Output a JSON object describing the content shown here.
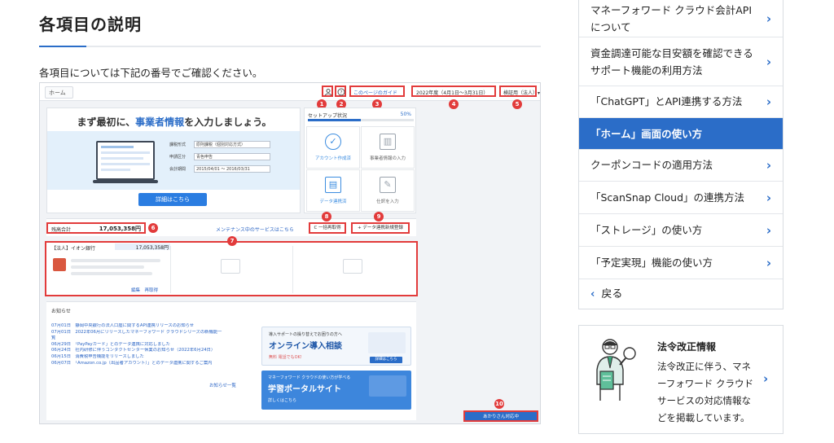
{
  "article": {
    "title": "各項目の説明",
    "lead": "各項目については下記の番号でご確認ください。"
  },
  "screenshot": {
    "breadcrumb": "ホーム",
    "header": {
      "guide_link": "このページのガイド",
      "fiscal_period": "2022年度（4月1日〜3月31日）",
      "user_menu": "検証用（法人）▾"
    },
    "markers": [
      "1",
      "2",
      "3",
      "4",
      "5",
      "6",
      "7",
      "8",
      "9",
      "10"
    ],
    "welcome": {
      "heading_pre": "まず最初に、",
      "heading_highlight": "事業者情報",
      "heading_post": "を入力しましょう。",
      "fields": [
        {
          "label": "課税形式",
          "value": "原則課税（個別対応方式）"
        },
        {
          "label": "申請区分",
          "value": "青色申告"
        },
        {
          "label": "会計期間",
          "value": "2015/04/01 〜 2016/03/31"
        }
      ],
      "detail_button": "詳細はこちら"
    },
    "setup": {
      "heading": "セットアップ状況",
      "percent": "50%",
      "progress": 0.5,
      "cells": [
        {
          "icon": "check-circle-icon",
          "label": "アカウント作成済",
          "done": true
        },
        {
          "icon": "building-icon",
          "label": "事業者情報の入力",
          "done": false
        },
        {
          "icon": "data-link-icon",
          "label": "データ連携済",
          "done": true
        },
        {
          "icon": "journal-entry-icon",
          "label": "仕訳を入力",
          "done": false
        }
      ]
    },
    "balance": {
      "label": "残高合計",
      "value": "17,053,358円",
      "maintenance_link": "メンテナンス中のサービスはこちら",
      "refresh_button": "C 一括再取得",
      "register_button": "+ データ連携新規登録"
    },
    "account": {
      "name": "【法人】イオン銀行",
      "amount": "17,053,358円",
      "links": "編集　再取得"
    },
    "news": {
      "heading": "お知らせ",
      "items": [
        "07月01日　静岡中央銀行の法人口座に関するAPI連携リリースのお知らせ",
        "07月01日　2022年06月にリリースしたマネーフォワード クラウドシリーズの新機能一",
        "覧",
        "06月29日　「PayPayカード」とのデータ連携に対応しました",
        "06月24日　社内研修に伴うコンタクトセンター休業のお知らせ（2022年6月24日）",
        "06月15日　消費税申告機能をリリースしました",
        "06月07日　「Amazon.co.jp（出品者アカウント）」とのデータ連携に関するご案内"
      ],
      "more_link": "お知らせ一覧",
      "banner1": {
        "sub": "導入サポートの操り替えでお困りの方へ",
        "title": "オンライン導入相談",
        "note": "無料 電話でもOK!",
        "button": "詳細はこちら"
      },
      "banner2": {
        "sub": "マネーフォワード クラウドの使い方が学べる",
        "title": "学習ポータルサイト",
        "link": "詳しくはこちら"
      }
    },
    "chat_button": "あかりさん対応中"
  },
  "sidebar": {
    "items": [
      {
        "label": "マネーフォワード クラウド会計APIについて",
        "active": false
      },
      {
        "label": "資金調達可能な目安額を確認できるサポート機能の利用方法",
        "active": false
      },
      {
        "label": "「ChatGPT」とAPI連携する方法",
        "active": false
      },
      {
        "label": "「ホーム」画面の使い方",
        "active": true
      },
      {
        "label": "クーポンコードの適用方法",
        "active": false
      },
      {
        "label": "「ScanSnap Cloud」の連携方法",
        "active": false
      },
      {
        "label": "「ストレージ」の使い方",
        "active": false
      },
      {
        "label": "「予定実現」機能の使い方",
        "active": false
      }
    ],
    "back_label": "戻る"
  },
  "law_box": {
    "title": "法令改正情報",
    "description": "法令改正に伴う、マネーフォワード クラウドサービスの対応情報などを掲載しています。"
  },
  "colors": {
    "accent": "#2b6dc8",
    "marker": "#e23b3b",
    "border": "#d9dde2"
  }
}
